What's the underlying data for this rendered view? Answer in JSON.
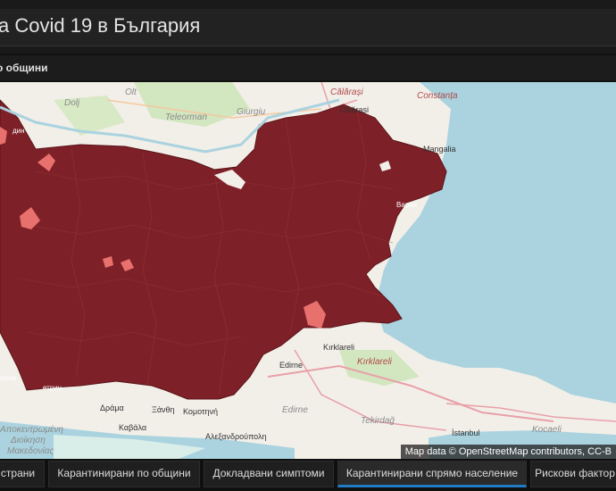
{
  "header": {
    "title": "a Covid 19 в България"
  },
  "subheader": {
    "title": "о общини"
  },
  "map": {
    "attribution": "Map data © OpenStreetMap contributors, CC-B",
    "colors": {
      "region_fill": "#7e2027",
      "highlight_fill": "#e8716e",
      "sea": "#aad3df",
      "land": "#f2efe9",
      "forest": "#d2e6bf"
    },
    "labels": {
      "calarasi": "Călărași",
      "constanta": "Constanța",
      "olt": "Olt",
      "dolj": "Dolj",
      "teleorman": "Teleorman",
      "giurgiu": "Giurgiu",
      "calarasi2": "Călărași",
      "mangalia": "Mangalia",
      "varna": "Варна",
      "din": "дин",
      "kirklareli_city": "Kırklareli",
      "kirklareli": "Kırklareli",
      "edirne_city": "Edirne",
      "edirne": "Edirne",
      "tekirdag": "Tekirdağ",
      "istanbul": "İstanbul",
      "kocaeli": "Kocaeli",
      "drama": "Δράμα",
      "xanthi": "Ξάνθη",
      "komotini": "Κομοτηνή",
      "kavala": "Καβάλα",
      "alexandroupoli": "Αλεξανδρούπολη",
      "apokentromeni": "Αποκεντρωμένη",
      "dioikisi": "Διοίκηση",
      "makedonias": "Μακεδονίας",
      "moche": "моче",
      "petrich": "етрич"
    }
  },
  "tabs": [
    {
      "label": "страни",
      "active": false
    },
    {
      "label": "Карантинирани по общини",
      "active": false
    },
    {
      "label": "Докладвани симптоми",
      "active": false
    },
    {
      "label": "Карантинирани спрямо население",
      "active": true
    },
    {
      "label": "Рискови фактор",
      "active": false
    }
  ]
}
